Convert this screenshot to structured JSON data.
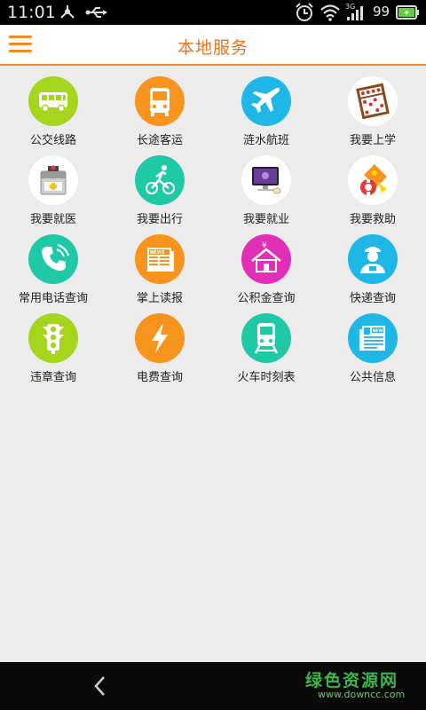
{
  "status_bar": {
    "time": "11:01",
    "network": "3G",
    "battery": "99"
  },
  "header": {
    "title": "本地服务",
    "menu_icon": "hamburger-menu-icon"
  },
  "colors": {
    "accent": "#f08a24",
    "title": "#e8731d",
    "lime": "#a6d51e",
    "orange": "#f7941d",
    "cyan": "#1fb7e6",
    "teal": "#1fc9a6",
    "magenta": "#e22fb8"
  },
  "services": [
    {
      "label": "公交线路",
      "icon": "bus-icon",
      "color": "#a6d51e"
    },
    {
      "label": "长途客运",
      "icon": "coach-icon",
      "color": "#f7941d"
    },
    {
      "label": "涟水航班",
      "icon": "airplane-icon",
      "color": "#1fb7e6"
    },
    {
      "label": "我要上学",
      "icon": "abacus-icon",
      "color": "#ffffff"
    },
    {
      "label": "我要就医",
      "icon": "medical-kit-icon",
      "color": "#ffffff"
    },
    {
      "label": "我要出行",
      "icon": "cyclist-icon",
      "color": "#1fc9a6"
    },
    {
      "label": "我要就业",
      "icon": "computer-icon",
      "color": "#ffffff"
    },
    {
      "label": "我要救助",
      "icon": "lifebuoy-icon",
      "color": "#ffffff"
    },
    {
      "label": "常用电话查询",
      "icon": "phone-icon",
      "color": "#1fc9a6"
    },
    {
      "label": "掌上读报",
      "icon": "newspaper-icon",
      "color": "#f7941d"
    },
    {
      "label": "公积金查询",
      "icon": "house-fund-icon",
      "color": "#e22fb8"
    },
    {
      "label": "快递查询",
      "icon": "courier-icon",
      "color": "#1fb7e6"
    },
    {
      "label": "违章查询",
      "icon": "traffic-light-icon",
      "color": "#a6d51e"
    },
    {
      "label": "电费查询",
      "icon": "lightning-icon",
      "color": "#f7941d"
    },
    {
      "label": "火车时刻表",
      "icon": "train-icon",
      "color": "#1fc9a6"
    },
    {
      "label": "公共信息",
      "icon": "news-paper-icon",
      "color": "#1fb7e6"
    }
  ],
  "navbar": {
    "back_icon": "back-chevron-icon"
  },
  "watermark": {
    "main": "绿色资源网",
    "url": "www.downcc.com"
  }
}
